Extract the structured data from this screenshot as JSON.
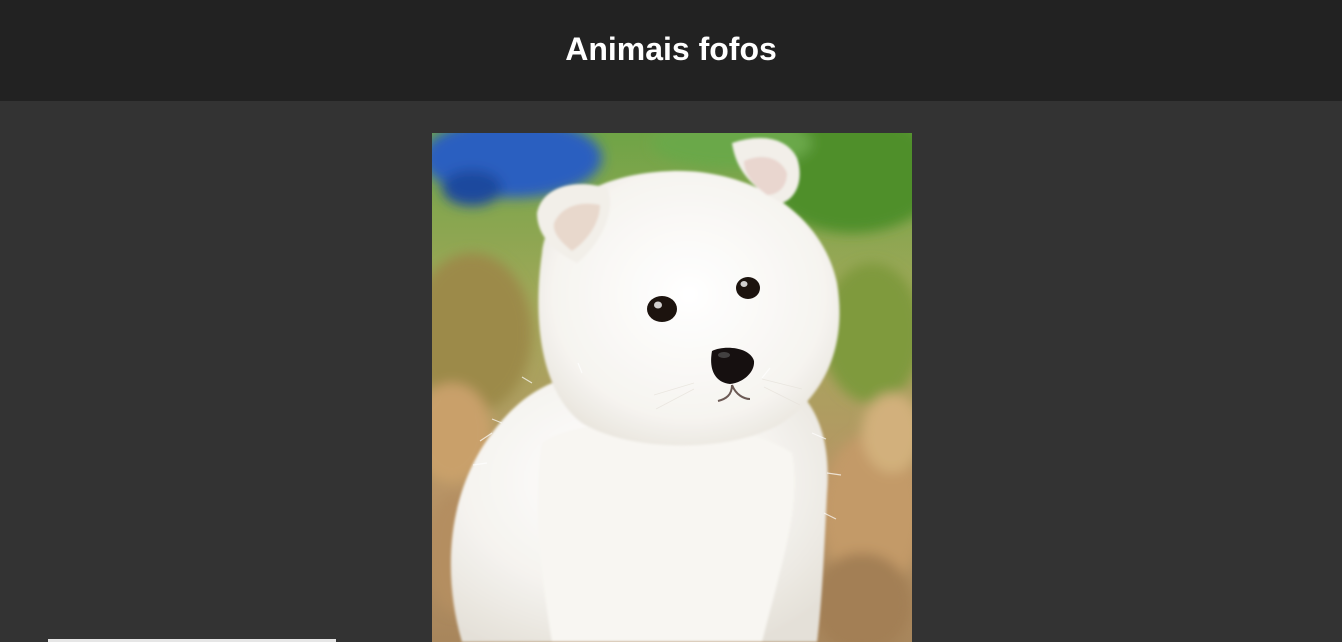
{
  "header": {
    "title": "Animais fofos"
  },
  "main": {
    "image": {
      "subject": "white-puppy",
      "colors": {
        "background": "#333333",
        "header": "#222222",
        "fur": "#f4f2ee",
        "grass": "#5f9a3a",
        "leaves": "#c9a06a",
        "blue_object": "#2a5fc0"
      }
    }
  }
}
